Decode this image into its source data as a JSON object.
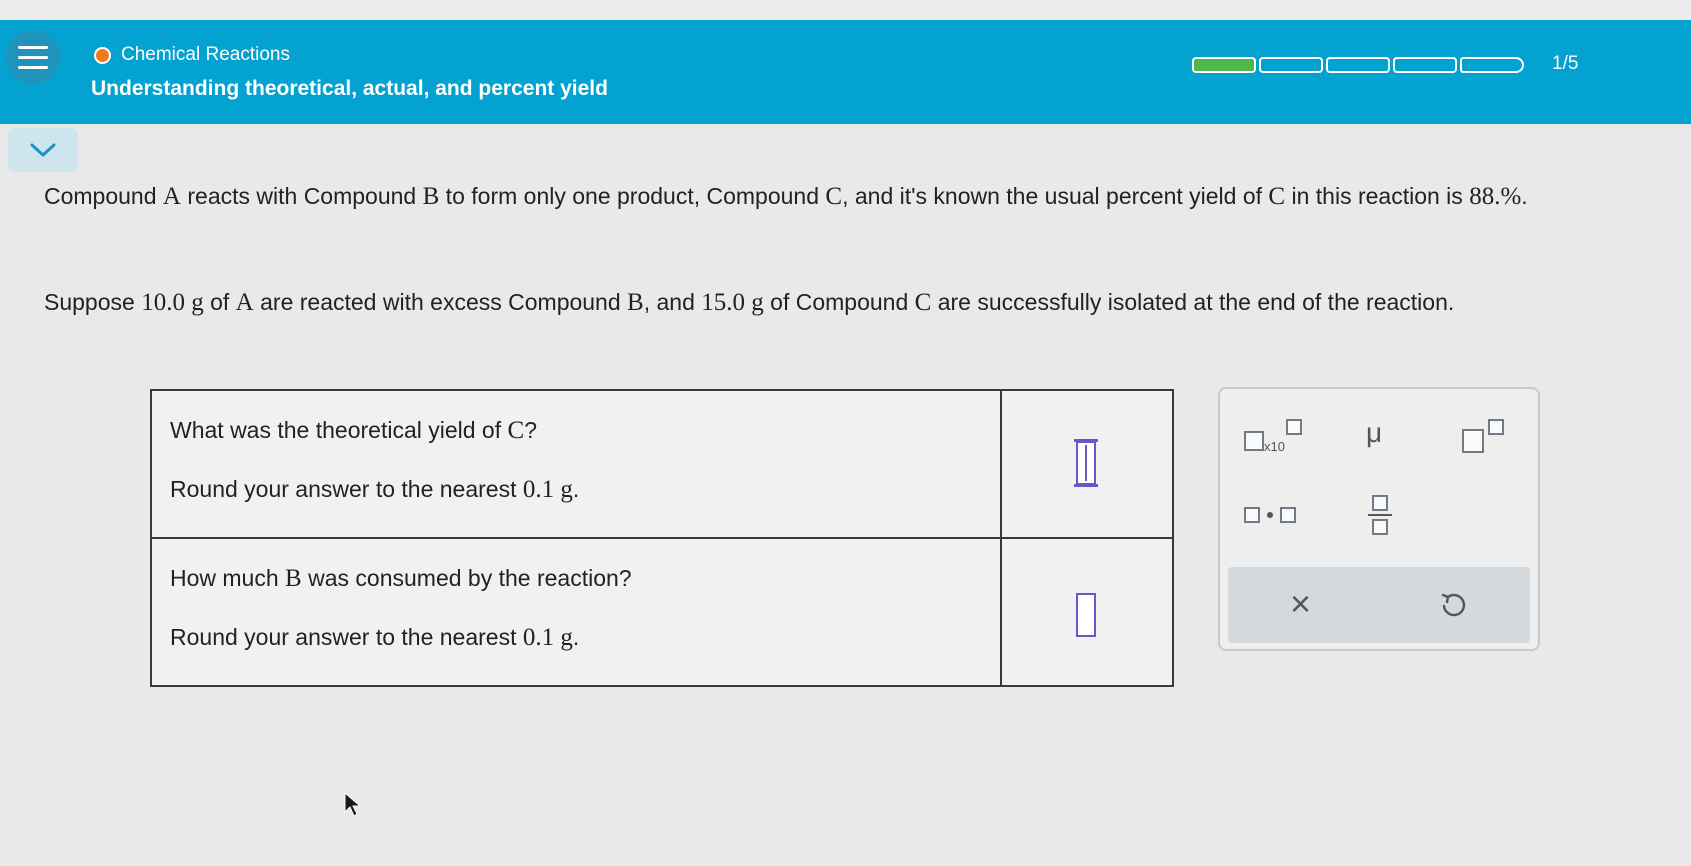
{
  "header": {
    "topic": "Chemical Reactions",
    "title": "Understanding theoretical, actual, and percent yield",
    "progress_text": "1/5",
    "progress_fraction": 0.2,
    "accent_color": "#04a2d0",
    "progress_fill_color": "#4fb84a",
    "topic_dot_color": "#f07a1e"
  },
  "problem": {
    "p1_parts": [
      "Compound ",
      "A",
      " reacts with Compound ",
      "B",
      " to form only one product, Compound ",
      "C",
      ", and it's known the usual percent yield of ",
      "C",
      " in this reaction is ",
      "88.%",
      "."
    ],
    "p2_parts": [
      "Suppose ",
      "10.0 g",
      " of ",
      "A",
      " are reacted with excess Compound ",
      "B",
      ", and ",
      "15.0 g",
      " of Compound ",
      "C",
      " are successfully isolated at the end of the reaction."
    ]
  },
  "questions": [
    {
      "q_parts": [
        "What was the theoretical yield of ",
        "C",
        "?"
      ],
      "round_parts": [
        "Round your answer to the nearest ",
        "0.1 g",
        "."
      ],
      "answer": ""
    },
    {
      "q_parts": [
        "How much ",
        "B",
        " was consumed by the reaction?"
      ],
      "round_parts": [
        "Round your answer to the nearest ",
        "0.1 g",
        "."
      ],
      "answer": ""
    }
  ],
  "toolbar": {
    "sci_notation_label": "x10",
    "mu_label": "μ",
    "clear_label": "×",
    "icons": [
      "scientific-notation-icon",
      "micro-symbol-icon",
      "superscript-icon",
      "multiply-dot-icon",
      "fraction-icon",
      "clear-icon",
      "undo-icon"
    ]
  }
}
